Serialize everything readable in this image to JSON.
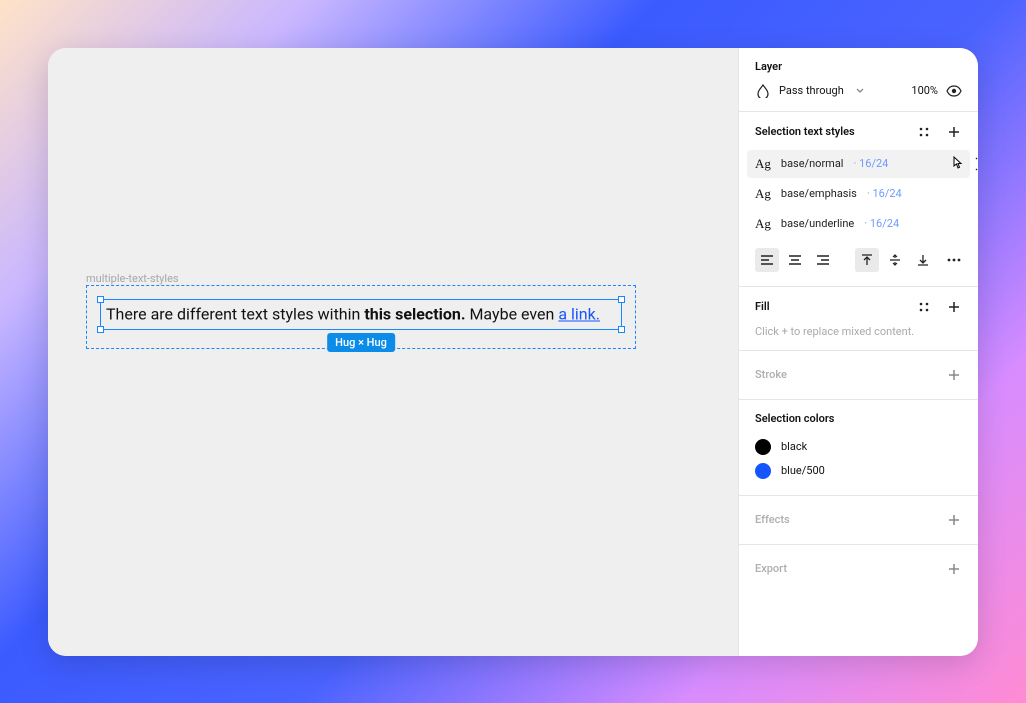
{
  "canvas": {
    "frame_label": "multiple-text-styles",
    "text_before": "There are different text styles within ",
    "text_emphasis": "this selection.",
    "text_middle": " Maybe even ",
    "text_link": "a link.",
    "size_badge": "Hug × Hug"
  },
  "layer": {
    "title": "Layer",
    "blend_mode": "Pass through",
    "opacity": "100%"
  },
  "text_styles": {
    "title": "Selection text styles",
    "ag": "Ag",
    "dot": " · ",
    "items": [
      {
        "name": "base/normal",
        "size": "16/24"
      },
      {
        "name": "base/emphasis",
        "size": "16/24"
      },
      {
        "name": "base/underline",
        "size": "16/24"
      }
    ]
  },
  "fill": {
    "title": "Fill",
    "hint": "Click + to replace mixed content."
  },
  "stroke": {
    "title": "Stroke"
  },
  "selection_colors": {
    "title": "Selection colors",
    "items": [
      {
        "name": "black",
        "hex": "#000000"
      },
      {
        "name": "blue/500",
        "hex": "#1555ff"
      }
    ]
  },
  "effects": {
    "title": "Effects"
  },
  "export": {
    "title": "Export"
  }
}
